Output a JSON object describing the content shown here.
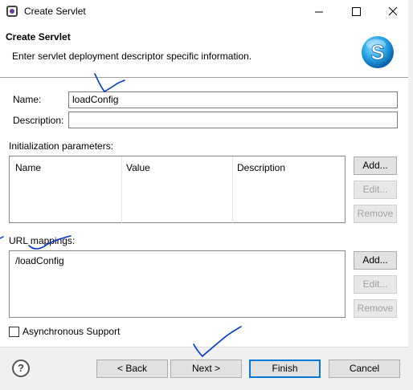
{
  "window": {
    "title": "Create Servlet",
    "controls": {
      "minimize": "minimize-icon",
      "maximize": "maximize-icon",
      "close": "close-icon"
    }
  },
  "banner": {
    "title": "Create Servlet",
    "message": "Enter servlet deployment descriptor specific information.",
    "logo_icon": "servlet-logo-icon",
    "logo_letter": "S"
  },
  "form": {
    "name_label": "Name:",
    "name_value": "loadConfig",
    "description_label": "Description:",
    "description_value": ""
  },
  "init_params": {
    "label": "Initialization parameters:",
    "columns": [
      "Name",
      "Value",
      "Description"
    ],
    "rows": [],
    "buttons": {
      "add": "Add...",
      "edit": "Edit...",
      "remove": "Remove"
    }
  },
  "url_mappings": {
    "label": "URL mappings:",
    "items": [
      "/loadConfig"
    ],
    "buttons": {
      "add": "Add...",
      "edit": "Edit...",
      "remove": "Remove"
    }
  },
  "async": {
    "label": "Asynchronous Support",
    "checked": false
  },
  "footer": {
    "help_icon": "help-icon",
    "help_glyph": "?",
    "back": "< Back",
    "next": "Next >",
    "finish": "Finish",
    "cancel": "Cancel"
  },
  "colors": {
    "accent": "#0078d7",
    "annotation": "#0033cc"
  }
}
